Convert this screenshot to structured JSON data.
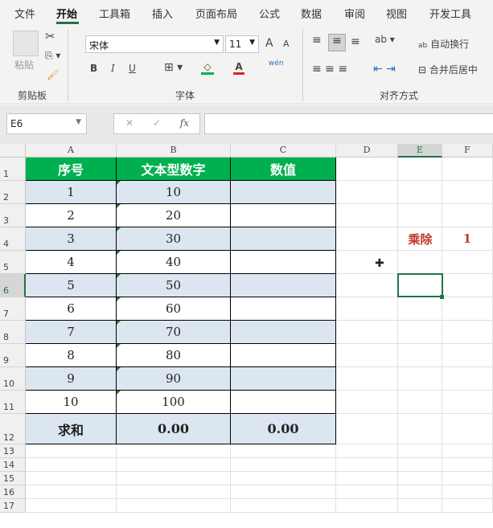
{
  "tabs": [
    "文件",
    "开始",
    "工具箱",
    "插入",
    "页面布局",
    "公式",
    "数据",
    "审阅",
    "视图",
    "开发工具"
  ],
  "ribbon": {
    "paste": "粘贴",
    "clipboard_group": "剪贴板",
    "font_name": "宋体",
    "font_size": "11",
    "font_group": "字体",
    "wrap_text": "自动换行",
    "merge_center": "合并后居中",
    "align_group": "对齐方式",
    "bold": "B",
    "italic": "I",
    "underline": "U",
    "grow": "A",
    "shrink": "A",
    "font_color": "A",
    "phonetic": "wén"
  },
  "formula_bar": {
    "name_box": "E6",
    "fx": "fx",
    "cancel": "✕",
    "enter": "✓",
    "value": ""
  },
  "columns": [
    "A",
    "B",
    "C",
    "D",
    "E",
    "F"
  ],
  "rows": [
    "1",
    "2",
    "3",
    "4",
    "5",
    "6",
    "7",
    "8",
    "9",
    "10",
    "11",
    "12",
    "13",
    "14",
    "15",
    "16",
    "17"
  ],
  "table": {
    "headers": [
      "序号",
      "文本型数字",
      "数值"
    ],
    "rows": [
      [
        "1",
        "10",
        ""
      ],
      [
        "2",
        "20",
        ""
      ],
      [
        "3",
        "30",
        ""
      ],
      [
        "4",
        "40",
        ""
      ],
      [
        "5",
        "50",
        ""
      ],
      [
        "6",
        "60",
        ""
      ],
      [
        "7",
        "70",
        ""
      ],
      [
        "8",
        "80",
        ""
      ],
      [
        "9",
        "90",
        ""
      ],
      [
        "10",
        "100",
        ""
      ]
    ],
    "total": [
      "求和",
      "0.00",
      "0.00"
    ]
  },
  "side": {
    "label": "乘除",
    "value": "1"
  },
  "colors": {
    "accent": "#217346",
    "header": "#00b050",
    "band": "#dce6f1",
    "red": "#c0392b"
  }
}
